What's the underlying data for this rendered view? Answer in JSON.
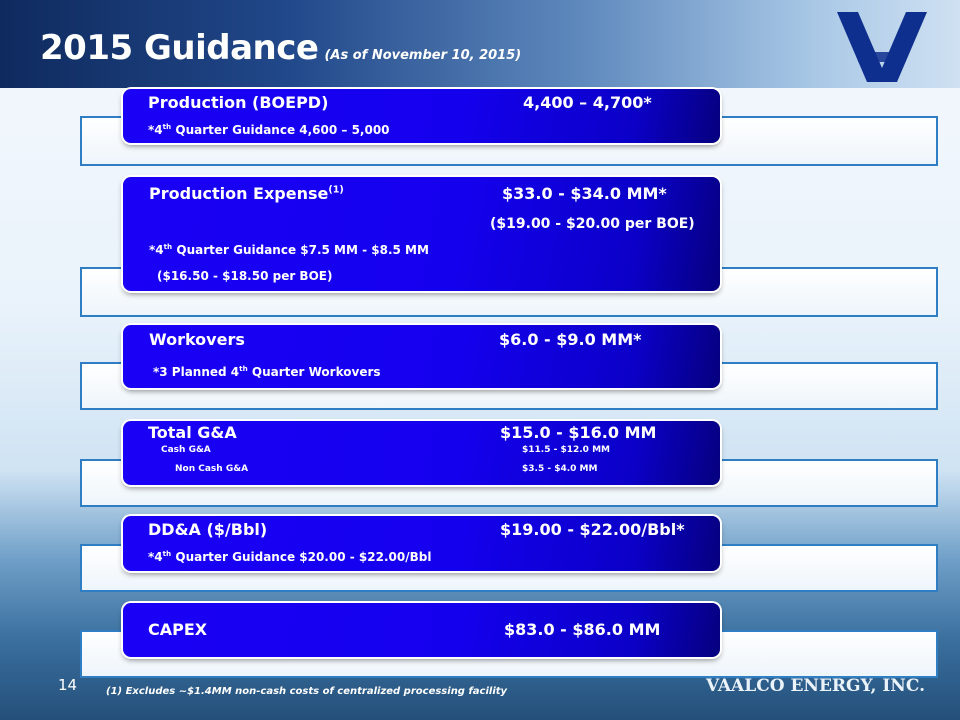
{
  "header": {
    "title": "2015 Guidance",
    "subtitle": "(As of November 10, 2015)"
  },
  "items": [
    {
      "label": "Production (BOEPD)",
      "value": "4,400 – 4,700*",
      "note_prefix": "*4",
      "note_sup": "th",
      "note": " Quarter Guidance 4,600 – 5,000"
    },
    {
      "label": "Production Expense",
      "label_sup": "(1)",
      "value": "$33.0 - $34.0 MM*",
      "value_sub": "($19.00 - $20.00 per BOE)",
      "note_prefix": "*4",
      "note_sup": "th",
      "note": " Quarter Guidance $7.5 MM - $8.5 MM",
      "note2": "($16.50 - $18.50 per BOE)"
    },
    {
      "label": "Workovers",
      "value": "$6.0 - $9.0 MM*",
      "note_prefix": "*3 Planned 4",
      "note_sup": "th",
      "note": " Quarter Workovers"
    },
    {
      "label": "Total G&A",
      "value": "$15.0 - $16.0 MM",
      "sub_rows": [
        {
          "label": "Cash G&A",
          "value": "$11.5 - $12.0 MM"
        },
        {
          "label": "Non Cash G&A",
          "value": "$3.5 - $4.0 MM"
        }
      ]
    },
    {
      "label": "DD&A ($/Bbl)",
      "value": "$19.00 - $22.00/Bbl*",
      "note_prefix": "*4",
      "note_sup": "th",
      "note": " Quarter Guidance $20.00 - $22.00/Bbl"
    },
    {
      "label": "CAPEX",
      "value": "$83.0 - $86.0 MM"
    }
  ],
  "footer": {
    "page_number": "14",
    "footnote": "(1) Excludes ~$1.4MM non-cash costs of centralized processing facility",
    "company": "VAALCO ENERGY, INC."
  },
  "colors": {
    "box_blue": "#1a00f5",
    "frame_border": "#2f7dc3",
    "header_dark": "#0f2a5e"
  }
}
